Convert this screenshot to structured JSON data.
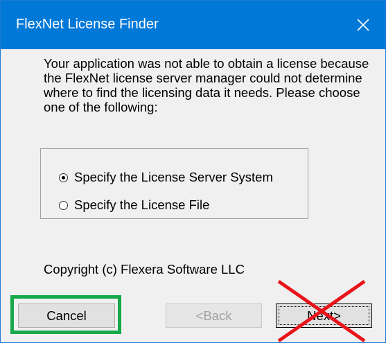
{
  "window": {
    "title": "FlexNet License Finder",
    "close_glyph": "✕"
  },
  "message": "Your application was not able to obtain a license because the FlexNet license server manager could not determine where to find the licensing data it needs.  Please choose one of the following:",
  "options": [
    {
      "label": "Specify the License Server System",
      "selected": true
    },
    {
      "label": "Specify the License File",
      "selected": false
    }
  ],
  "copyright": "Copyright (c) Flexera Software LLC",
  "buttons": {
    "cancel": "Cancel",
    "back": "<Back",
    "next": "Next>"
  },
  "annotations": {
    "cancel_highlight_color": "#17a84a",
    "next_cross_color": "#e8141a"
  },
  "colors": {
    "titlebar": "#0078d7",
    "dialog_bg": "#f0f0f0"
  }
}
